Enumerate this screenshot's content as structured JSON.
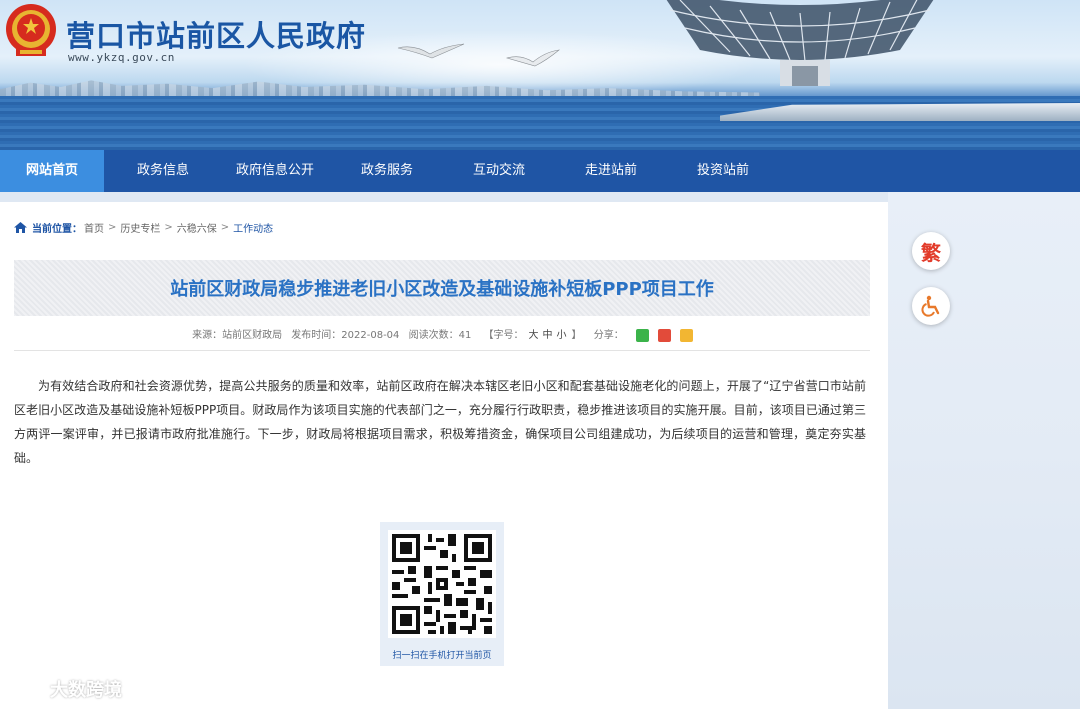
{
  "header": {
    "site_title": "营口市站前区人民政府",
    "site_url": "www.ykzq.gov.cn"
  },
  "nav": {
    "items": [
      {
        "label": "网站首页",
        "active": true
      },
      {
        "label": "政务信息",
        "active": false
      },
      {
        "label": "政府信息公开",
        "active": false
      },
      {
        "label": "政务服务",
        "active": false
      },
      {
        "label": "互动交流",
        "active": false
      },
      {
        "label": "走进站前",
        "active": false
      },
      {
        "label": "投资站前",
        "active": false
      }
    ]
  },
  "breadcrumb": {
    "label": "当前位置：",
    "items": [
      "首页",
      "历史专栏",
      "六稳六保",
      "工作动态"
    ],
    "separator": ">"
  },
  "article": {
    "title": "站前区财政局稳步推进老旧小区改造及基础设施补短板PPP项目工作",
    "source": "来源：站前区财政局",
    "published": "发布时间：2022-08-04",
    "views": "阅读次数：41",
    "font_size_open": "【字号：",
    "font_sizes": [
      "大",
      "中",
      "小"
    ],
    "font_size_close": "】",
    "share_label": "分享：",
    "body": "为有效结合政府和社会资源优势，提高公共服务的质量和效率，站前区政府在解决本辖区老旧小区和配套基础设施老化的问题上，开展了“辽宁省营口市站前区老旧小区改造及基础设施补短板PPP项目。财政局作为该项目实施的代表部门之一，充分履行行政职责，稳步推进该项目的实施开展。目前，该项目已通过第三方两评一案评审，并已报请市政府批准施行。下一步，财政局将根据项目需求，积极筹措资金，确保项目公司组建成功，为后续项目的运营和管理，奠定夯实基础。"
  },
  "qr": {
    "caption": "扫一扫在手机打开当前页"
  },
  "sidebar": {
    "traditional_label": "繁"
  },
  "watermark": {
    "text": "大数跨境"
  },
  "colors": {
    "nav_bg": "#1f55a5",
    "nav_active": "#3c8ee0",
    "title_blue": "#2a72c4",
    "site_title": "#1a56a4"
  }
}
